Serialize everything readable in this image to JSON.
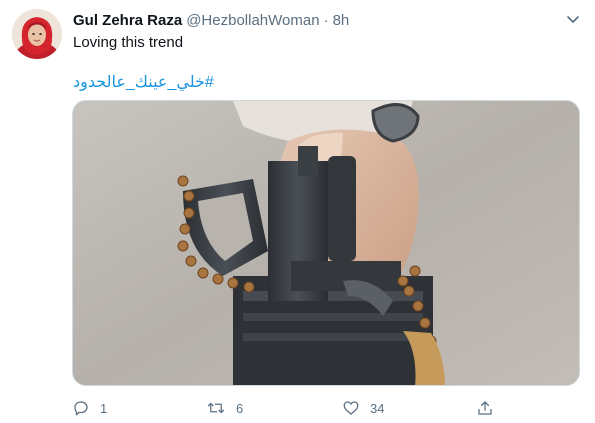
{
  "tweet": {
    "author": {
      "display_name": "Gul Zehra Raza",
      "handle": "@HezbollahWoman",
      "separator": "·",
      "time": "8h"
    },
    "text": "Loving this trend",
    "hashtag": "#خلي_عينك_عالحدود",
    "media": {
      "icon": "photo"
    },
    "actions": {
      "reply_count": "1",
      "retweet_count": "6",
      "like_count": "34"
    }
  },
  "colors": {
    "link": "#1b95e0",
    "secondary_text": "#5b7083",
    "primary_text": "#0f1419",
    "border": "#cfd9de"
  },
  "icons": {
    "reply": "reply-icon",
    "retweet": "retweet-icon",
    "like": "heart-icon",
    "share": "share-icon",
    "more": "chevron-down-icon"
  }
}
